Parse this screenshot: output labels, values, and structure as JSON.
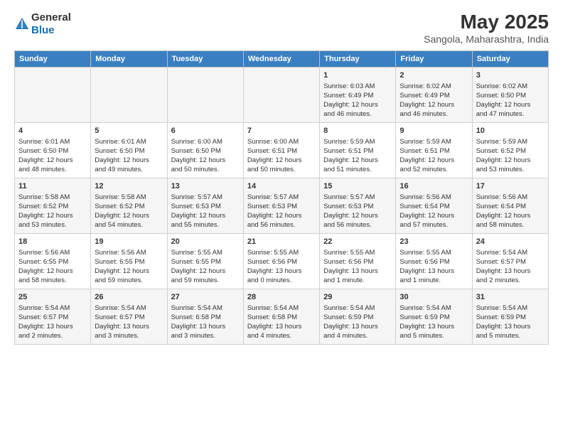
{
  "header": {
    "logo_general": "General",
    "logo_blue": "Blue",
    "title": "May 2025",
    "subtitle": "Sangola, Maharashtra, India"
  },
  "weekdays": [
    "Sunday",
    "Monday",
    "Tuesday",
    "Wednesday",
    "Thursday",
    "Friday",
    "Saturday"
  ],
  "weeks": [
    [
      {
        "day": "",
        "info": ""
      },
      {
        "day": "",
        "info": ""
      },
      {
        "day": "",
        "info": ""
      },
      {
        "day": "",
        "info": ""
      },
      {
        "day": "1",
        "info": "Sunrise: 6:03 AM\nSunset: 6:49 PM\nDaylight: 12 hours\nand 46 minutes."
      },
      {
        "day": "2",
        "info": "Sunrise: 6:02 AM\nSunset: 6:49 PM\nDaylight: 12 hours\nand 46 minutes."
      },
      {
        "day": "3",
        "info": "Sunrise: 6:02 AM\nSunset: 6:50 PM\nDaylight: 12 hours\nand 47 minutes."
      }
    ],
    [
      {
        "day": "4",
        "info": "Sunrise: 6:01 AM\nSunset: 6:50 PM\nDaylight: 12 hours\nand 48 minutes."
      },
      {
        "day": "5",
        "info": "Sunrise: 6:01 AM\nSunset: 6:50 PM\nDaylight: 12 hours\nand 49 minutes."
      },
      {
        "day": "6",
        "info": "Sunrise: 6:00 AM\nSunset: 6:50 PM\nDaylight: 12 hours\nand 50 minutes."
      },
      {
        "day": "7",
        "info": "Sunrise: 6:00 AM\nSunset: 6:51 PM\nDaylight: 12 hours\nand 50 minutes."
      },
      {
        "day": "8",
        "info": "Sunrise: 5:59 AM\nSunset: 6:51 PM\nDaylight: 12 hours\nand 51 minutes."
      },
      {
        "day": "9",
        "info": "Sunrise: 5:59 AM\nSunset: 6:51 PM\nDaylight: 12 hours\nand 52 minutes."
      },
      {
        "day": "10",
        "info": "Sunrise: 5:59 AM\nSunset: 6:52 PM\nDaylight: 12 hours\nand 53 minutes."
      }
    ],
    [
      {
        "day": "11",
        "info": "Sunrise: 5:58 AM\nSunset: 6:52 PM\nDaylight: 12 hours\nand 53 minutes."
      },
      {
        "day": "12",
        "info": "Sunrise: 5:58 AM\nSunset: 6:52 PM\nDaylight: 12 hours\nand 54 minutes."
      },
      {
        "day": "13",
        "info": "Sunrise: 5:57 AM\nSunset: 6:53 PM\nDaylight: 12 hours\nand 55 minutes."
      },
      {
        "day": "14",
        "info": "Sunrise: 5:57 AM\nSunset: 6:53 PM\nDaylight: 12 hours\nand 56 minutes."
      },
      {
        "day": "15",
        "info": "Sunrise: 5:57 AM\nSunset: 6:53 PM\nDaylight: 12 hours\nand 56 minutes."
      },
      {
        "day": "16",
        "info": "Sunrise: 5:56 AM\nSunset: 6:54 PM\nDaylight: 12 hours\nand 57 minutes."
      },
      {
        "day": "17",
        "info": "Sunrise: 5:56 AM\nSunset: 6:54 PM\nDaylight: 12 hours\nand 58 minutes."
      }
    ],
    [
      {
        "day": "18",
        "info": "Sunrise: 5:56 AM\nSunset: 6:55 PM\nDaylight: 12 hours\nand 58 minutes."
      },
      {
        "day": "19",
        "info": "Sunrise: 5:56 AM\nSunset: 6:55 PM\nDaylight: 12 hours\nand 59 minutes."
      },
      {
        "day": "20",
        "info": "Sunrise: 5:55 AM\nSunset: 6:55 PM\nDaylight: 12 hours\nand 59 minutes."
      },
      {
        "day": "21",
        "info": "Sunrise: 5:55 AM\nSunset: 6:56 PM\nDaylight: 13 hours\nand 0 minutes."
      },
      {
        "day": "22",
        "info": "Sunrise: 5:55 AM\nSunset: 6:56 PM\nDaylight: 13 hours\nand 1 minute."
      },
      {
        "day": "23",
        "info": "Sunrise: 5:55 AM\nSunset: 6:56 PM\nDaylight: 13 hours\nand 1 minute."
      },
      {
        "day": "24",
        "info": "Sunrise: 5:54 AM\nSunset: 6:57 PM\nDaylight: 13 hours\nand 2 minutes."
      }
    ],
    [
      {
        "day": "25",
        "info": "Sunrise: 5:54 AM\nSunset: 6:57 PM\nDaylight: 13 hours\nand 2 minutes."
      },
      {
        "day": "26",
        "info": "Sunrise: 5:54 AM\nSunset: 6:57 PM\nDaylight: 13 hours\nand 3 minutes."
      },
      {
        "day": "27",
        "info": "Sunrise: 5:54 AM\nSunset: 6:58 PM\nDaylight: 13 hours\nand 3 minutes."
      },
      {
        "day": "28",
        "info": "Sunrise: 5:54 AM\nSunset: 6:58 PM\nDaylight: 13 hours\nand 4 minutes."
      },
      {
        "day": "29",
        "info": "Sunrise: 5:54 AM\nSunset: 6:59 PM\nDaylight: 13 hours\nand 4 minutes."
      },
      {
        "day": "30",
        "info": "Sunrise: 5:54 AM\nSunset: 6:59 PM\nDaylight: 13 hours\nand 5 minutes."
      },
      {
        "day": "31",
        "info": "Sunrise: 5:54 AM\nSunset: 6:59 PM\nDaylight: 13 hours\nand 5 minutes."
      }
    ]
  ]
}
